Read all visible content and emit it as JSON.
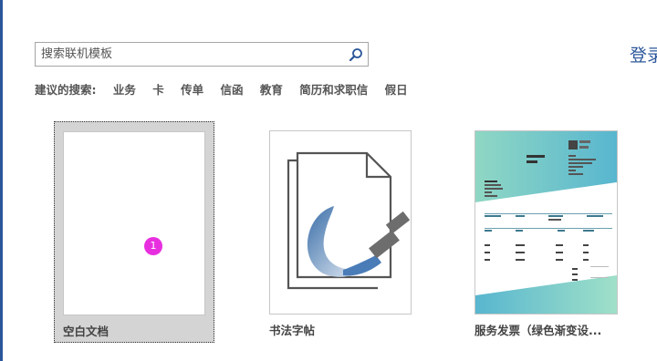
{
  "header": {
    "signin_label": "登录"
  },
  "search": {
    "placeholder": "搜索联机模板"
  },
  "suggested": {
    "label": "建议的搜索:",
    "items": [
      "业务",
      "卡",
      "传单",
      "信函",
      "教育",
      "简历和求职信",
      "假日"
    ]
  },
  "templates": [
    {
      "caption": "空白文档",
      "badge": "1"
    },
    {
      "caption": "书法字帖"
    },
    {
      "caption": "服务发票（绿色渐变设..."
    }
  ],
  "colors": {
    "accent": "#2b579a",
    "badge": "#e82fe0",
    "selected_tile_bg": "#d4d4d4"
  },
  "icons": {
    "search": "magnifier-icon",
    "calligraphy": "brush-page-icon"
  }
}
